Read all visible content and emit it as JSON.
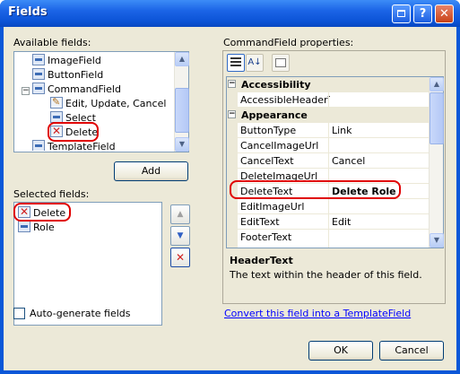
{
  "window": {
    "title": "Fields",
    "title_buttons": [
      "restore",
      "help",
      "close"
    ],
    "help_glyph": "?",
    "close_glyph": "✕"
  },
  "available_fields": {
    "label": "Available fields:",
    "items": [
      {
        "label": "ImageField",
        "icon": "field-icon",
        "indent": 1
      },
      {
        "label": "ButtonField",
        "icon": "field-icon",
        "indent": 1
      },
      {
        "label": "CommandField",
        "icon": "field-icon",
        "indent": 1,
        "expanded": true
      },
      {
        "label": "Edit, Update, Cancel",
        "icon": "edit-icon",
        "indent": 2
      },
      {
        "label": "Select",
        "icon": "field-icon",
        "indent": 2
      },
      {
        "label": "Delete",
        "icon": "delete-icon",
        "indent": 2,
        "highlighted": true
      },
      {
        "label": "TemplateField",
        "icon": "field-icon",
        "indent": 1
      }
    ],
    "expander_glyph": "−",
    "add_button": "Add"
  },
  "selected_fields": {
    "label": "Selected fields:",
    "items": [
      {
        "label": "Delete",
        "icon": "delete-icon",
        "highlighted": true
      },
      {
        "label": "Role",
        "icon": "field-icon"
      }
    ]
  },
  "order_buttons": {
    "up_glyph": "▲",
    "down_glyph": "▼",
    "remove_glyph": "✕"
  },
  "autogenerate": {
    "label": "Auto-generate fields",
    "checked": false
  },
  "properties": {
    "label": "CommandField properties:",
    "toolbar": [
      "categorized-icon",
      "alphabetical-icon",
      "property-pages-icon"
    ],
    "alphabetical_glyph": "A↓",
    "categories": [
      {
        "name": "Accessibility",
        "rows": [
          {
            "name": "AccessibleHeaderTe",
            "value": ""
          }
        ]
      },
      {
        "name": "Appearance",
        "rows": [
          {
            "name": "ButtonType",
            "value": "Link"
          },
          {
            "name": "CancelImageUrl",
            "value": ""
          },
          {
            "name": "CancelText",
            "value": "Cancel"
          },
          {
            "name": "DeleteImageUrl",
            "value": ""
          },
          {
            "name": "DeleteText",
            "value": "Delete Role",
            "bold": true,
            "highlighted": true
          },
          {
            "name": "EditImageUrl",
            "value": ""
          },
          {
            "name": "EditText",
            "value": "Edit"
          },
          {
            "name": "FooterText",
            "value": ""
          }
        ]
      }
    ],
    "collapse_glyph": "−",
    "description": {
      "title": "HeaderText",
      "text": "The text within the header of this field."
    },
    "convert_link": "Convert this field into a TemplateField"
  },
  "footer": {
    "ok": "OK",
    "cancel": "Cancel"
  },
  "colors": {
    "titlebar": "#0a57d8",
    "client": "#ece9d8",
    "highlight": "#e00000",
    "link": "#0000ff"
  }
}
